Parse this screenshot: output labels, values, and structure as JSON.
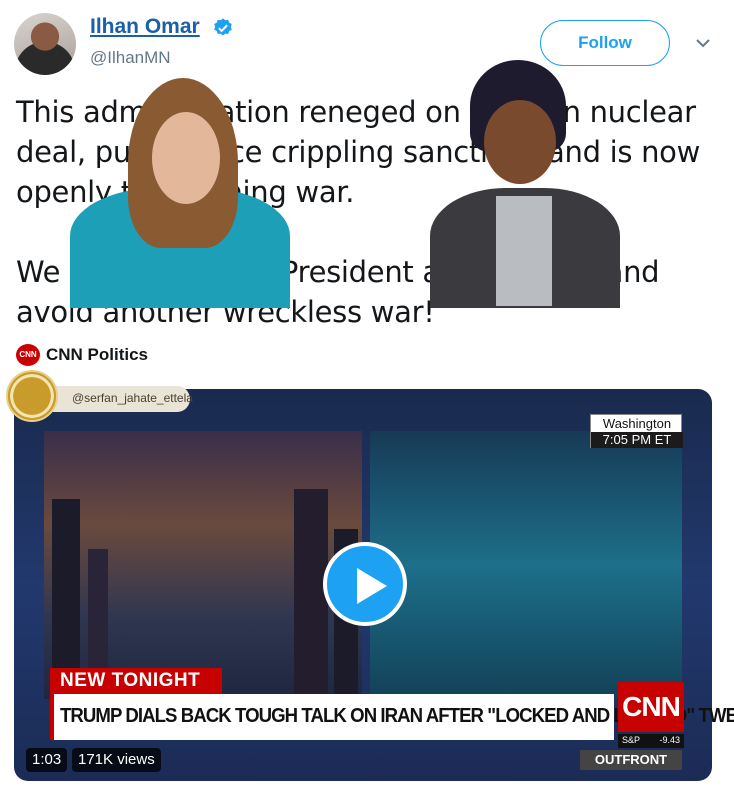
{
  "tweet": {
    "author_name": "Ilhan Omar",
    "author_handle": "@IlhanMN",
    "follow_label": "Follow",
    "text_paragraphs": [
      "This administration reneged on the Iran nuclear deal, put in place crippling sanctions and is now openly threatening war.",
      "We must hold this President accountable and avoid another wreckless war!"
    ],
    "card_source": "CNN Politics",
    "card_source_logo_text": "CNN"
  },
  "video": {
    "watermark_handle": "@serfan_jahate_ettela",
    "location_city": "Washington",
    "location_time": "7:05 PM ET",
    "banner_label": "NEW TONIGHT",
    "headline": "TRUMP DIALS BACK TOUGH TALK ON IRAN AFTER \"LOCKED AND LOADED\" TWEET",
    "network_logo": "CNN",
    "ticker_label": "S&P",
    "ticker_value": "-9.43",
    "show_name": "OUTFRONT",
    "duration": "1:03",
    "views": "171K views"
  },
  "colors": {
    "link_blue": "#1b5fa8",
    "twitter_blue": "#1da1f2",
    "cnn_red": "#c70000"
  }
}
